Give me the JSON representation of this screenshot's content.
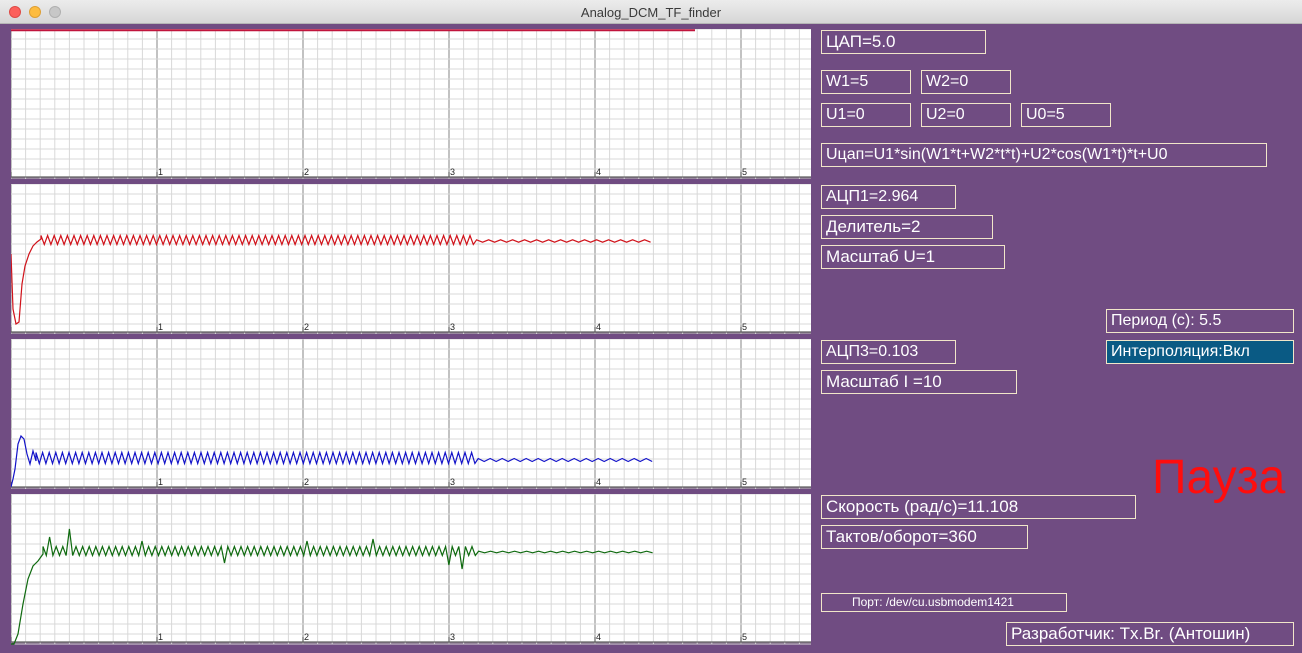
{
  "window": {
    "title": "Analog_DCM_TF_finder"
  },
  "plots": [
    {
      "id": "dac",
      "color": "#c0143c",
      "x_ticks": [
        "1",
        "2",
        "3",
        "4",
        "5"
      ]
    },
    {
      "id": "adc1",
      "color": "#d0121a",
      "x_ticks": [
        "1",
        "2",
        "3",
        "4",
        "5"
      ]
    },
    {
      "id": "adc3",
      "color": "#1212c8",
      "x_ticks": [
        "1",
        "2",
        "3",
        "4",
        "5"
      ]
    },
    {
      "id": "speed",
      "color": "#0f6a0f",
      "x_ticks": [
        "1",
        "2",
        "3",
        "4",
        "5"
      ]
    }
  ],
  "fields": {
    "dac": "ЦАП=5.0",
    "w1": "W1=5",
    "w2": "W2=0",
    "u1": "U1=0",
    "u2": "U2=0",
    "u0": "U0=5",
    "formula": "Uцап=U1*sin(W1*t+W2*t*t)+U2*cos(W1*t)*t+U0",
    "adc1": "АЦП1=2.964",
    "divider": "Делитель=2",
    "scale_u": "Масштаб U=1",
    "period": "Период (с): 5.5",
    "adc3": "АЦП3=0.103",
    "interp": "Интерполяция:Вкл",
    "scale_i": "Масштаб I =10",
    "speed": "Скорость (рад/с)=11.108",
    "ticks": "Тактов/оборот=360",
    "port": "Порт: /dev/cu.usbmodem1421",
    "author": "Разработчик: Tx.Br. (Антошин)"
  },
  "status": {
    "pause": "Пауза",
    "pause_color": "#ff0d0d",
    "interp_bg": "#0a5a84"
  }
}
